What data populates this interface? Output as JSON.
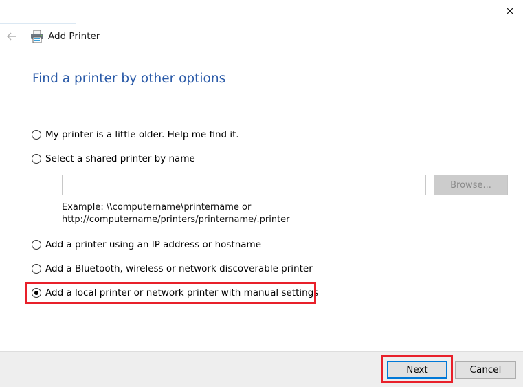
{
  "window": {
    "title": "Add Printer",
    "icons": {
      "close": "close-icon",
      "back": "back-arrow-icon",
      "app": "printer-icon"
    }
  },
  "page": {
    "heading": "Find a printer by other options"
  },
  "options": [
    {
      "label": "My printer is a little older. Help me find it.",
      "checked": false
    },
    {
      "label": "Select a shared printer by name",
      "checked": false
    },
    {
      "label": "Add a printer using an IP address or hostname",
      "checked": false
    },
    {
      "label": "Add a Bluetooth, wireless or network discoverable printer",
      "checked": false
    },
    {
      "label": "Add a local printer or network printer with manual settings",
      "checked": true
    }
  ],
  "shared_printer": {
    "input_value": "",
    "browse_label": "Browse...",
    "example_line1": "Example: \\\\computername\\printername or",
    "example_line2": "http://computername/printers/printername/.printer"
  },
  "footer": {
    "next_label": "Next",
    "cancel_label": "Cancel"
  },
  "colors": {
    "heading": "#2a5aa8",
    "highlight": "#e8202a",
    "focus": "#0078d7",
    "footer_bg": "#eeeeee"
  }
}
